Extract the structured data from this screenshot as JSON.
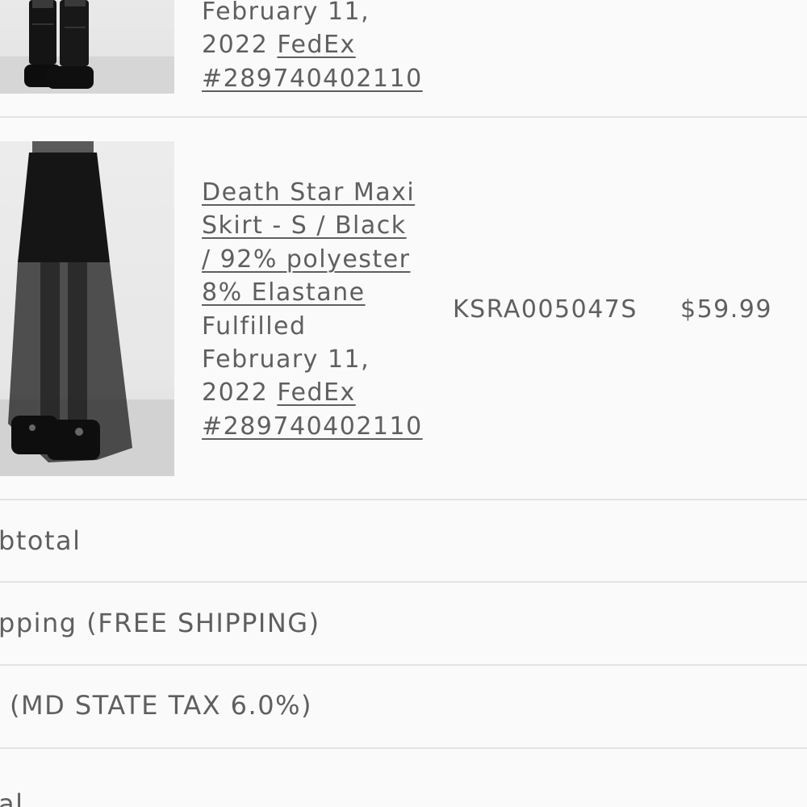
{
  "items": [
    {
      "image_alt": "Black platform boots",
      "status_lines": [
        "February 11,",
        "2022 "
      ],
      "carrier": "FedEx",
      "tracking": "#289740402110"
    },
    {
      "image_alt": "Death Star Maxi Skirt",
      "title_lines": [
        "Death Star Maxi",
        "Skirt - S / Black",
        "/ 92% polyester",
        "8% Elastane"
      ],
      "status_lines": [
        "Fulfilled",
        "February 11,",
        "2022 "
      ],
      "carrier": "FedEx",
      "tracking": "#289740402110",
      "sku": "KSRA005047S",
      "price": "$59.99"
    }
  ],
  "summary": {
    "subtotal_label": "btotal",
    "shipping_label": "pping (FREE SHIPPING)",
    "tax_label": "(MD STATE TAX 6.0%)",
    "total_label": "al"
  }
}
